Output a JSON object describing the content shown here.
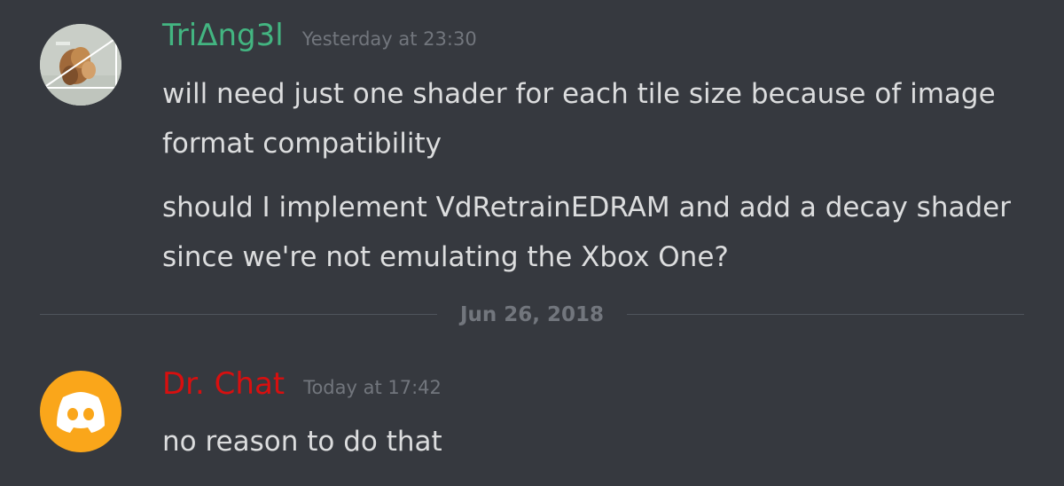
{
  "colors": {
    "background": "#36393f",
    "message_text": "#dcddde",
    "timestamp_text": "#72767d",
    "divider_text": "#72767d",
    "divider_line": "#4f545c",
    "username_1": "#43b581",
    "username_2": "#d80f0f",
    "avatar_2_bg": "#faa61a"
  },
  "messages": [
    {
      "username": "TriΔng3l",
      "timestamp": "Yesterday at 23:30",
      "avatar_icon": "photo-avatar",
      "lines": [
        "will need just one shader for each tile size because of image format compatibility",
        "should I implement VdRetrainEDRAM and add a decay shader since we're not emulating the Xbox One?"
      ]
    },
    {
      "username": "Dr. Chat",
      "timestamp": "Today at 17:42",
      "avatar_icon": "discord-logo-icon",
      "lines": [
        "no reason to do that"
      ]
    }
  ],
  "date_divider": {
    "label": "Jun 26, 2018"
  }
}
